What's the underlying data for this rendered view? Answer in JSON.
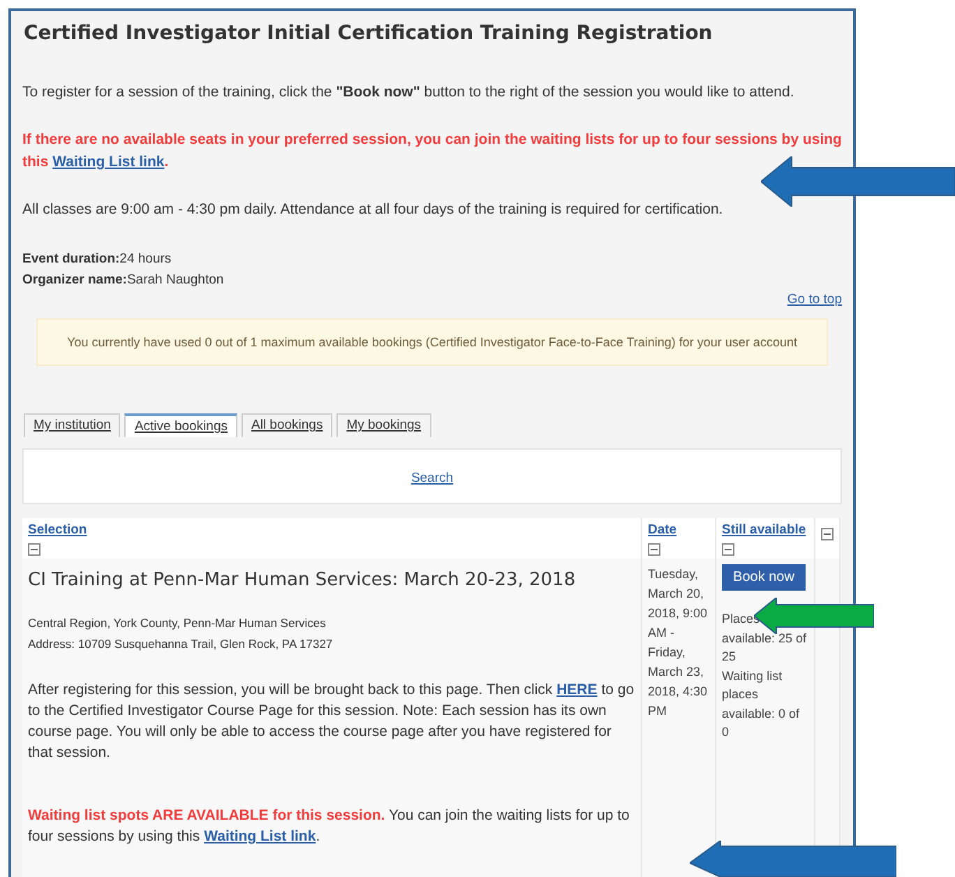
{
  "title": "Certified Investigator Initial Certification Training Registration",
  "intro": "To register for a session of the training, click the **\"Book now\"** button to the right of the session you would like to attend.",
  "red_notice": {
    "text": "If there are no available seats in your preferred session, you can join the waiting lists for up to four sessions by using this",
    "link": "Waiting List link",
    "after": "."
  },
  "schedule_note": "All classes are 9:00 am - 4:30 pm daily. Attendance at all four days of the training is required for certification.",
  "details": [
    {
      "label": "Event duration:",
      "value": "24 hours"
    },
    {
      "label": "Organizer name:",
      "value": "Sarah Naughton"
    }
  ],
  "go_to_top": "Go to top",
  "booking_notice": "You currently have used 0 out of 1 maximum available bookings (Certified Investigator Face-to-Face Training) for your user account",
  "tabs": [
    {
      "label": "My institution",
      "selected": false
    },
    {
      "label": "Active bookings",
      "selected": true
    },
    {
      "label": "All bookings",
      "selected": false
    },
    {
      "label": "My bookings",
      "selected": false
    }
  ],
  "search_link": "Search",
  "table": {
    "columns": [
      "Selection",
      "Date",
      "Still available"
    ],
    "rows": [
      {
        "session_title": "CI Training at Penn-Mar Human Services: March 20-23, 2018",
        "location": "Central Region, York County, Penn-Mar Human Services",
        "address": "Address: 10709 Susquehanna Trail, Glen Rock, PA 17327",
        "description": {
          "text": "After registering for this session, you will be brought back to this page. Then click",
          "link": "HERE",
          "after": "to go to the Certified Investigator Course Page for this session. Note: Each session has its own course page. You will only be able to access the course page after you have registered for that session."
        },
        "waiting": {
          "text": "**Waiting list spots ARE AVAILABLE for this session.** You can join the waiting lists for up to four sessions by using this",
          "link": "Waiting List link",
          "after": "."
        },
        "date": "Tuesday, March 20, 2018, 9:00 AM - Friday, March 23, 2018, 4:30 PM",
        "button": "Book now",
        "places": "Places available: 25 of 25",
        "waiting_places": "Waiting list places available: 0 of 0"
      }
    ]
  }
}
